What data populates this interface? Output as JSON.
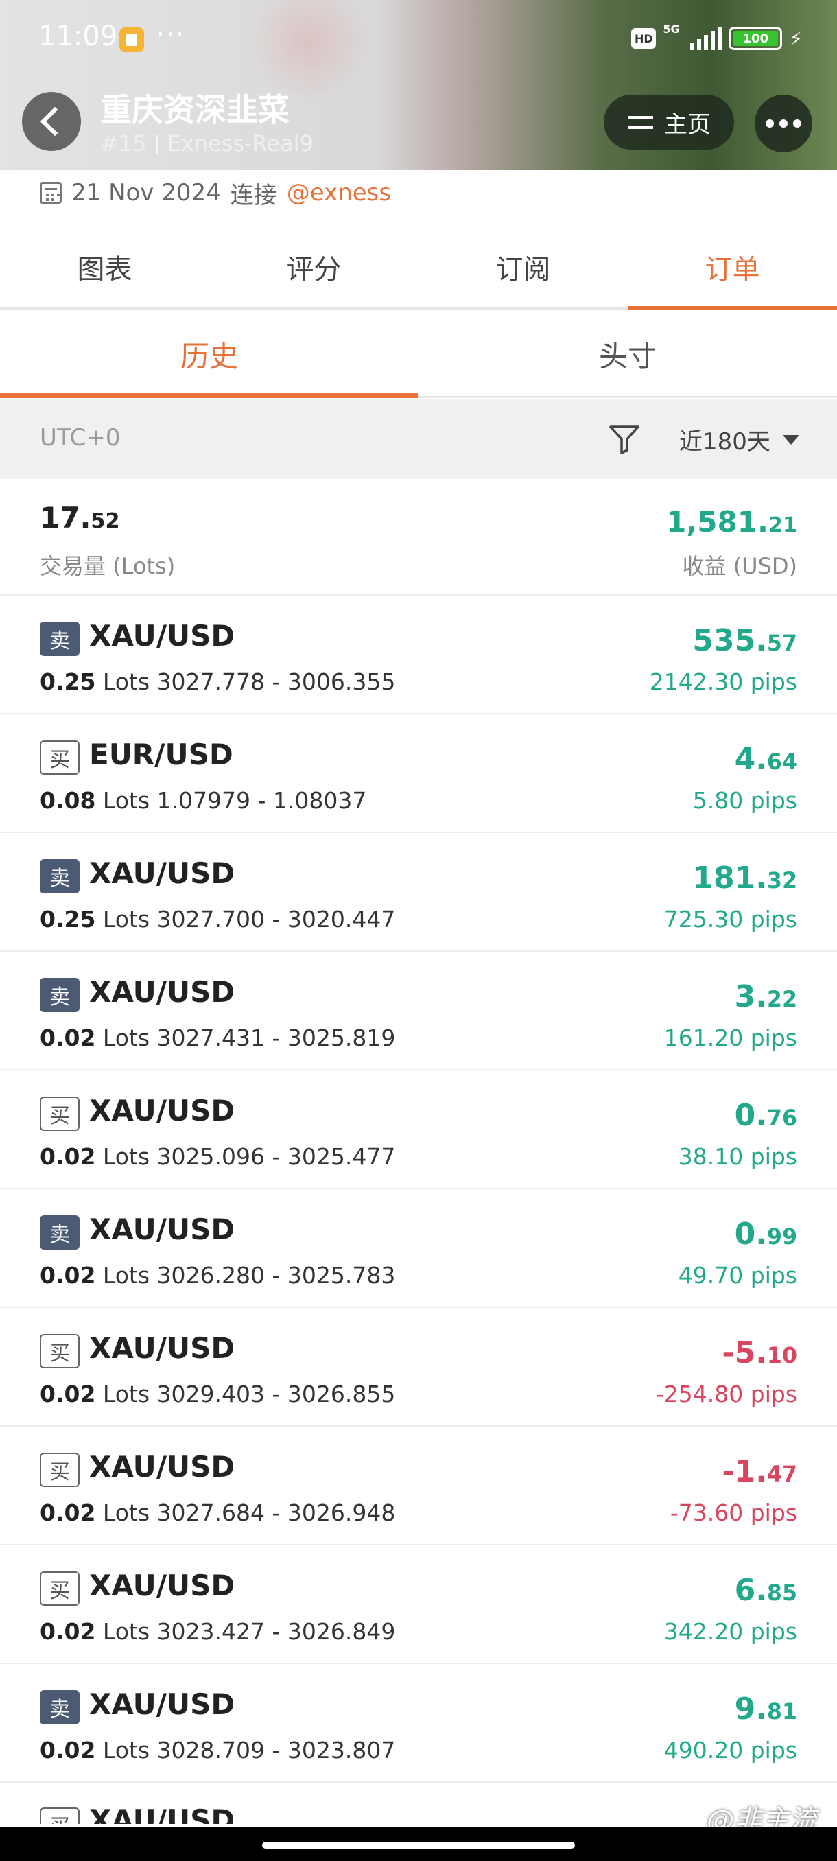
{
  "status_bar": {
    "time": "11:09",
    "dots": "···",
    "hd": "HD",
    "network": "5G",
    "battery": "100",
    "bolt": "⚡"
  },
  "header": {
    "title": "重庆资深韭菜",
    "rank": "#15",
    "account": "Exness-Real9",
    "home_label": "主页"
  },
  "connect": {
    "date": "21 Nov 2024",
    "connect_text": "连接",
    "broker": "@exness"
  },
  "main_tabs": [
    "图表",
    "评分",
    "订阅",
    "订单"
  ],
  "active_main_tab": 3,
  "sub_tabs": [
    "历史",
    "头寸"
  ],
  "filter": {
    "timezone": "UTC+0",
    "range": "近180天"
  },
  "summary": {
    "volume_int": "17.",
    "volume_dec": "52",
    "volume_label": "交易量 (Lots)",
    "profit_int": "1,581.",
    "profit_dec": "21",
    "profit_label": "收益 (USD)"
  },
  "orders": [
    {
      "side": "卖",
      "type": "sell",
      "symbol": "XAU/USD",
      "lots": "0.25",
      "lots_unit": "Lots",
      "prices": "3027.778 - 3006.355",
      "amt_int": "535.",
      "amt_dec": "57",
      "pips": "2142.30 pips",
      "sign": "pos"
    },
    {
      "side": "买",
      "type": "buy",
      "symbol": "EUR/USD",
      "lots": "0.08",
      "lots_unit": "Lots",
      "prices": "1.07979 - 1.08037",
      "amt_int": "4.",
      "amt_dec": "64",
      "pips": "5.80 pips",
      "sign": "pos"
    },
    {
      "side": "卖",
      "type": "sell",
      "symbol": "XAU/USD",
      "lots": "0.25",
      "lots_unit": "Lots",
      "prices": "3027.700 - 3020.447",
      "amt_int": "181.",
      "amt_dec": "32",
      "pips": "725.30 pips",
      "sign": "pos"
    },
    {
      "side": "卖",
      "type": "sell",
      "symbol": "XAU/USD",
      "lots": "0.02",
      "lots_unit": "Lots",
      "prices": "3027.431 - 3025.819",
      "amt_int": "3.",
      "amt_dec": "22",
      "pips": "161.20 pips",
      "sign": "pos"
    },
    {
      "side": "买",
      "type": "buy",
      "symbol": "XAU/USD",
      "lots": "0.02",
      "lots_unit": "Lots",
      "prices": "3025.096 - 3025.477",
      "amt_int": "0.",
      "amt_dec": "76",
      "pips": "38.10 pips",
      "sign": "pos"
    },
    {
      "side": "卖",
      "type": "sell",
      "symbol": "XAU/USD",
      "lots": "0.02",
      "lots_unit": "Lots",
      "prices": "3026.280 - 3025.783",
      "amt_int": "0.",
      "amt_dec": "99",
      "pips": "49.70 pips",
      "sign": "pos"
    },
    {
      "side": "买",
      "type": "buy",
      "symbol": "XAU/USD",
      "lots": "0.02",
      "lots_unit": "Lots",
      "prices": "3029.403 - 3026.855",
      "amt_int": "-5.",
      "amt_dec": "10",
      "pips": "-254.80 pips",
      "sign": "neg"
    },
    {
      "side": "买",
      "type": "buy",
      "symbol": "XAU/USD",
      "lots": "0.02",
      "lots_unit": "Lots",
      "prices": "3027.684 - 3026.948",
      "amt_int": "-1.",
      "amt_dec": "47",
      "pips": "-73.60 pips",
      "sign": "neg"
    },
    {
      "side": "买",
      "type": "buy",
      "symbol": "XAU/USD",
      "lots": "0.02",
      "lots_unit": "Lots",
      "prices": "3023.427 - 3026.849",
      "amt_int": "6.",
      "amt_dec": "85",
      "pips": "342.20 pips",
      "sign": "pos"
    },
    {
      "side": "卖",
      "type": "sell",
      "symbol": "XAU/USD",
      "lots": "0.02",
      "lots_unit": "Lots",
      "prices": "3028.709 - 3023.807",
      "amt_int": "9.",
      "amt_dec": "81",
      "pips": "490.20 pips",
      "sign": "pos"
    }
  ],
  "partial_order": {
    "side": "买",
    "type": "buy",
    "symbol": "XAU/USD"
  },
  "watermark": "@非主流",
  "colors": {
    "accent": "#e8733a",
    "positive": "#22a88a",
    "negative": "#d9445f",
    "sell_badge": "#4d5a73"
  }
}
